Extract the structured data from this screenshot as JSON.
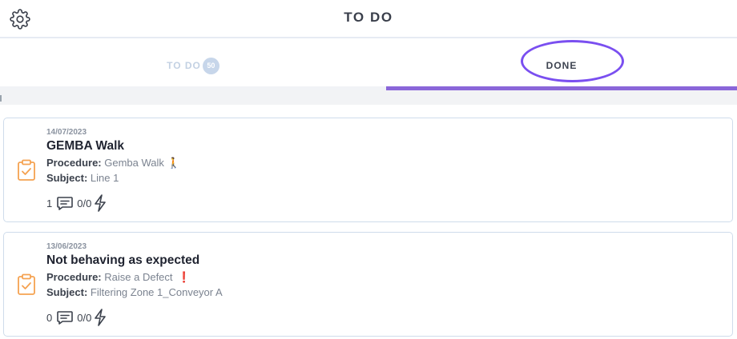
{
  "header": {
    "title": "TO DO",
    "settings_icon": "gear-icon"
  },
  "tabs": [
    {
      "label": "TO DO",
      "badge": "50",
      "active": false
    },
    {
      "label": "DONE",
      "active": true
    }
  ],
  "colors": {
    "accent": "#8a66d9",
    "annotation_ellipse": "#7a4ff0",
    "inactive_tab": "#c3d1e3",
    "card_icon": "#f5a251",
    "error": "#e0242b"
  },
  "cards": [
    {
      "date": "14/07/2023",
      "title": "GEMBA Walk",
      "procedure_label": "Procedure:",
      "procedure_value": "Gemba Walk",
      "procedure_emoji": "🚶",
      "subject_label": "Subject:",
      "subject_value": "Line 1",
      "comments": "1",
      "actions": "0/0",
      "icon": "clipboard-check-icon"
    },
    {
      "date": "13/06/2023",
      "title": "Not behaving as expected",
      "procedure_label": "Procedure:",
      "procedure_value": "Raise a Defect",
      "procedure_emoji": "❗",
      "subject_label": "Subject:",
      "subject_value": "Filtering Zone 1_Conveyor A",
      "comments": "0",
      "actions": "0/0",
      "icon": "clipboard-check-icon"
    }
  ]
}
